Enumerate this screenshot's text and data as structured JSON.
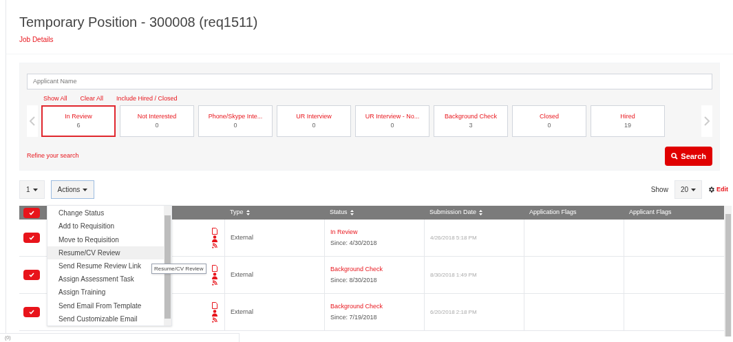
{
  "page": {
    "title": "Temporary Position - 300008 (req1511)",
    "subtitle_link": "Job Details"
  },
  "filter": {
    "search": {
      "placeholder": "Applicant Name"
    },
    "links": [
      "Show All",
      "Clear All",
      "Include Hired / Closed"
    ],
    "statuses": [
      {
        "label": "In Review",
        "count": "6",
        "selected": true
      },
      {
        "label": "Not Interested",
        "count": "0",
        "selected": false
      },
      {
        "label": "Phone/Skype Inte...",
        "count": "0",
        "selected": false
      },
      {
        "label": "UR Interview",
        "count": "0",
        "selected": false
      },
      {
        "label": "UR Interview - No...",
        "count": "0",
        "selected": false
      },
      {
        "label": "Background Check",
        "count": "3",
        "selected": false
      },
      {
        "label": "Closed",
        "count": "0",
        "selected": false
      },
      {
        "label": "Hired",
        "count": "19",
        "selected": false
      }
    ],
    "refine_link": "Refine your search",
    "search_button": "Search"
  },
  "toolbar": {
    "page_select": "1",
    "actions_button": "Actions",
    "show_label": "Show",
    "page_size": "20",
    "edit_link": "Edit"
  },
  "actions_menu": {
    "items": [
      {
        "label": "Change Status",
        "selected": false
      },
      {
        "label": "Add to Requisition",
        "selected": false
      },
      {
        "label": "Move to Requisition",
        "selected": false
      },
      {
        "label": "Resume/CV Review",
        "selected": true
      },
      {
        "label": "Send Resume Review Link",
        "selected": false
      },
      {
        "label": "Assign Assessment Task",
        "selected": false
      },
      {
        "label": "Assign Training",
        "selected": false
      },
      {
        "label": "Send Email From Template",
        "selected": false
      },
      {
        "label": "Send Customizable Email",
        "selected": false
      }
    ],
    "tooltip": "Resume/CV Review"
  },
  "table": {
    "header_checked": true,
    "columns": [
      {
        "label": "Type",
        "sortable": true
      },
      {
        "label": "Status",
        "sortable": true
      },
      {
        "label": "Submission Date",
        "sortable": true
      },
      {
        "label": "Application Flags",
        "sortable": false
      },
      {
        "label": "Applicant Flags",
        "sortable": false
      }
    ],
    "rows": [
      {
        "checked": true,
        "type": "External",
        "status": "In Review",
        "since": "Since: 4/30/2018",
        "submitted": "4/26/2018 5:18 PM"
      },
      {
        "checked": true,
        "type": "External",
        "status": "Background Check",
        "since": "Since: 8/30/2018",
        "submitted": "8/30/2018 1:49 PM"
      },
      {
        "checked": true,
        "type": "External",
        "status": "Background Check",
        "since": "Since: 7/19/2018",
        "submitted": "6/20/2018 2:18 PM"
      }
    ]
  },
  "status_bar": "(0)"
}
